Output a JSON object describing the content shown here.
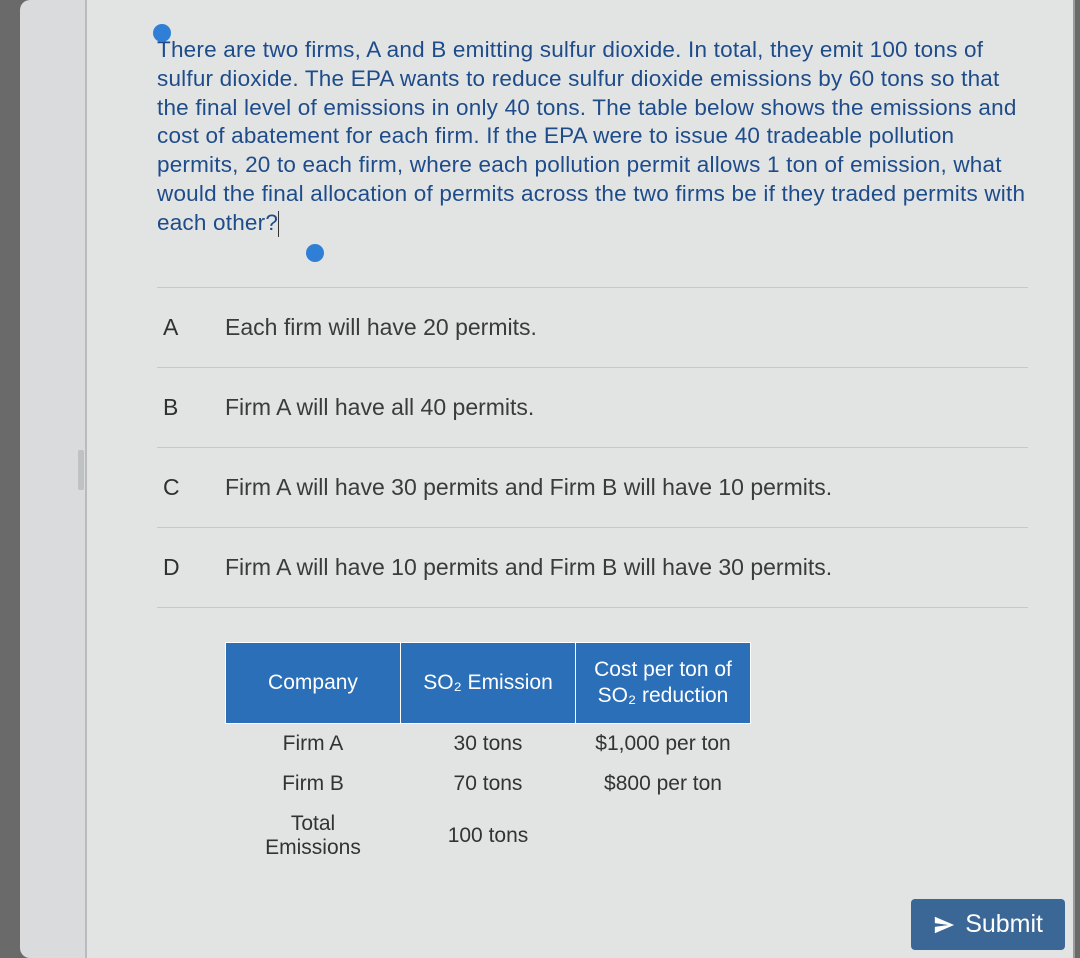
{
  "question": {
    "text": "There are two firms, A and B emitting sulfur dioxide. In total, they emit 100 tons of sulfur dioxide. The EPA wants to reduce sulfur dioxide emissions by 60 tons so that the final level of emissions in only 40 tons. The table below shows the emissions and cost of abatement for each firm.\nIf the EPA were to issue 40 tradeable pollution permits, 20 to each firm, where each pollution permit allows 1 ton of emission, what would the final allocation of permits across the two firms be if they traded permits with each other?"
  },
  "options": [
    {
      "letter": "A",
      "text": "Each firm will have 20 permits."
    },
    {
      "letter": "B",
      "text": "Firm A will have all 40 permits."
    },
    {
      "letter": "C",
      "text": "Firm A will have 30 permits and Firm B will have 10 permits."
    },
    {
      "letter": "D",
      "text": "Firm A will have 10 permits and Firm B will have 30 permits."
    }
  ],
  "table": {
    "headers": {
      "c1": "Company",
      "c2": "SO₂ Emission",
      "c3": "Cost per ton of SO₂ reduction"
    },
    "rows": [
      {
        "c1": "Firm A",
        "c2": "30 tons",
        "c3": "$1,000 per ton"
      },
      {
        "c1": "Firm B",
        "c2": "70 tons",
        "c3": "$800 per ton"
      },
      {
        "c1": "Total Emissions",
        "c2": "100 tons",
        "c3": ""
      }
    ]
  },
  "submit_label": "Submit"
}
